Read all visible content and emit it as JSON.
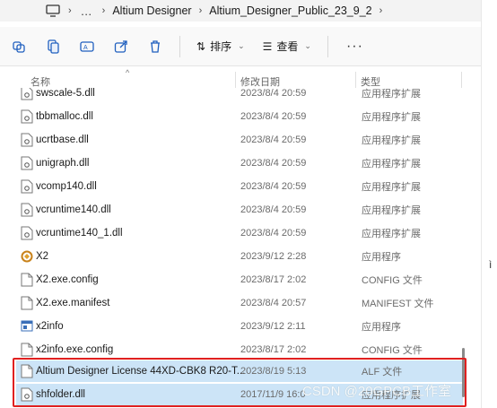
{
  "address": {
    "crumbs": [
      "Altium Designer",
      "Altium_Designer_Public_23_9_2"
    ],
    "more": "…"
  },
  "toolbar": {
    "sort_label": "排序",
    "view_label": "查看",
    "more": "···"
  },
  "columns": {
    "name": "名称",
    "date": "修改日期",
    "type": "类型"
  },
  "files": [
    {
      "name": "swscale-5.dll",
      "date": "2023/8/4 20:59",
      "type": "应用程序扩展",
      "icon": "dll-icon"
    },
    {
      "name": "tbbmalloc.dll",
      "date": "2023/8/4 20:59",
      "type": "应用程序扩展",
      "icon": "dll-icon"
    },
    {
      "name": "ucrtbase.dll",
      "date": "2023/8/4 20:59",
      "type": "应用程序扩展",
      "icon": "dll-icon"
    },
    {
      "name": "unigraph.dll",
      "date": "2023/8/4 20:59",
      "type": "应用程序扩展",
      "icon": "dll-icon"
    },
    {
      "name": "vcomp140.dll",
      "date": "2023/8/4 20:59",
      "type": "应用程序扩展",
      "icon": "dll-icon"
    },
    {
      "name": "vcruntime140.dll",
      "date": "2023/8/4 20:59",
      "type": "应用程序扩展",
      "icon": "dll-icon"
    },
    {
      "name": "vcruntime140_1.dll",
      "date": "2023/8/4 20:59",
      "type": "应用程序扩展",
      "icon": "dll-icon"
    },
    {
      "name": "X2",
      "date": "2023/9/12 2:28",
      "type": "应用程序",
      "icon": "app-icon"
    },
    {
      "name": "X2.exe.config",
      "date": "2023/8/17 2:02",
      "type": "CONFIG 文件",
      "icon": "file-icon"
    },
    {
      "name": "X2.exe.manifest",
      "date": "2023/8/4 20:57",
      "type": "MANIFEST 文件",
      "icon": "file-icon"
    },
    {
      "name": "x2info",
      "date": "2023/9/12 2:11",
      "type": "应用程序",
      "icon": "window-app-icon"
    },
    {
      "name": "x2info.exe.config",
      "date": "2023/8/17 2:02",
      "type": "CONFIG 文件",
      "icon": "file-icon"
    },
    {
      "name": "Altium Designer License 44XD-CBK8 R20-T...",
      "date": "2023/8/19 5:13",
      "type": "ALF 文件",
      "icon": "file-icon",
      "selected": true
    },
    {
      "name": "shfolder.dll",
      "date": "2017/11/9 16:0",
      "type": "应用程序扩展",
      "icon": "dll-icon",
      "selected": true
    }
  ],
  "watermark": "CSDN @20GPCB工作室",
  "edge_char": "ì",
  "colors": {
    "selection": "#cce4f7",
    "highlight": "#e02020",
    "accent": "#1f5fbf"
  }
}
